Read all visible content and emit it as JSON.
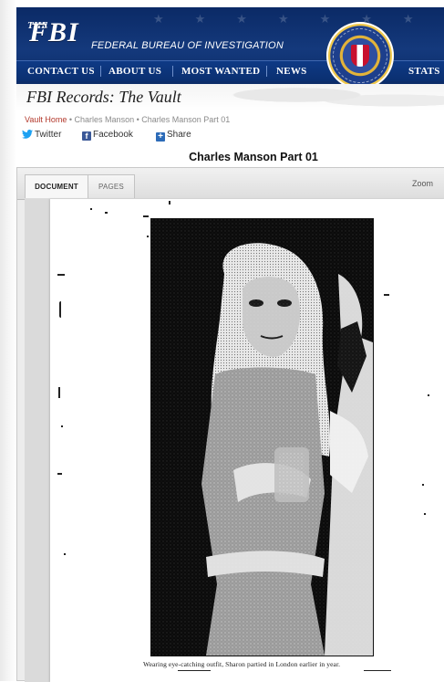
{
  "header": {
    "logo_the": "THE",
    "logo_fbi": "FBI",
    "logo_subtitle": "FEDERAL BUREAU OF INVESTIGATION",
    "nav": [
      {
        "label": "CONTACT US"
      },
      {
        "label": "ABOUT US"
      },
      {
        "label": "MOST WANTED"
      },
      {
        "label": "NEWS"
      },
      {
        "label": "STATS &"
      }
    ]
  },
  "vault": {
    "title": "FBI Records: The Vault"
  },
  "breadcrumb": {
    "home": "Vault Home",
    "sep": "•",
    "item1": "Charles Manson",
    "item2": "Charles Manson Part 01"
  },
  "social": {
    "twitter": "Twitter",
    "facebook": "Facebook",
    "share": "Share"
  },
  "document": {
    "title": "Charles Manson Part 01"
  },
  "viewer": {
    "tabs": [
      {
        "label": "DOCUMENT",
        "active": true
      },
      {
        "label": "PAGES",
        "active": false
      }
    ],
    "zoom_label": "Zoom",
    "caption": "Wearing eye-catching outfit, Sharon partied in London earlier in year."
  }
}
